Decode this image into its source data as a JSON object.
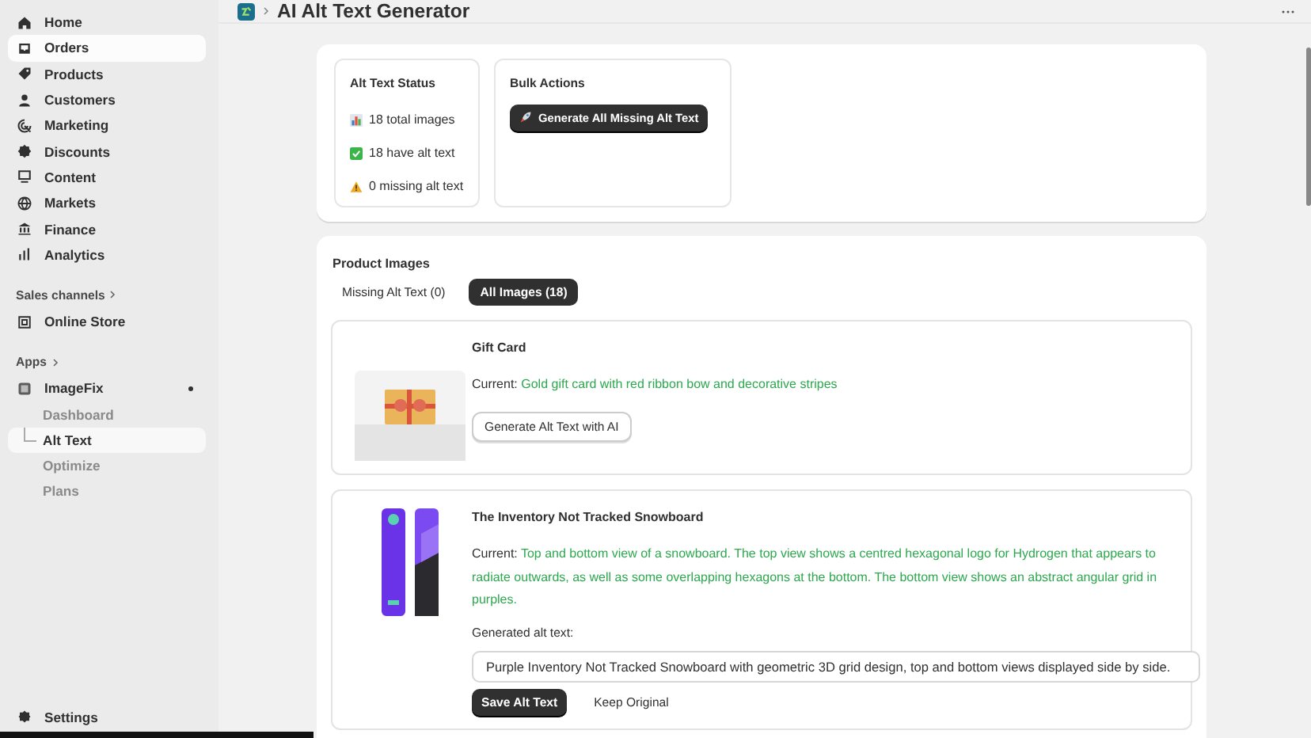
{
  "sidebar": {
    "nav": [
      {
        "label": "Home",
        "selected": false
      },
      {
        "label": "Orders",
        "selected": true
      },
      {
        "label": "Products",
        "selected": false
      },
      {
        "label": "Customers",
        "selected": false
      },
      {
        "label": "Marketing",
        "selected": false
      },
      {
        "label": "Discounts",
        "selected": false
      },
      {
        "label": "Content",
        "selected": false
      },
      {
        "label": "Markets",
        "selected": false
      },
      {
        "label": "Finance",
        "selected": false
      },
      {
        "label": "Analytics",
        "selected": false
      }
    ],
    "sales_channels": {
      "label": "Sales channels",
      "items": [
        {
          "label": "Online Store"
        }
      ]
    },
    "apps": {
      "label": "Apps",
      "items": [
        {
          "label": "ImageFix",
          "children": [
            {
              "label": "Dashboard",
              "selected": false
            },
            {
              "label": "Alt Text",
              "selected": true
            },
            {
              "label": "Optimize",
              "selected": false
            },
            {
              "label": "Plans",
              "selected": false
            }
          ]
        }
      ]
    },
    "settings": "Settings"
  },
  "header": {
    "title": "AI Alt Text Generator"
  },
  "status": {
    "title": "Alt Text Status",
    "stats": [
      {
        "kind": "chart",
        "text": "18 total images"
      },
      {
        "kind": "check",
        "text": "18 have alt text"
      },
      {
        "kind": "warning",
        "text": "0 missing alt text"
      }
    ]
  },
  "bulk": {
    "title": "Bulk Actions",
    "button": "Generate All Missing Alt Text"
  },
  "product_images": {
    "title": "Product Images",
    "tabs": [
      {
        "label": "Missing Alt Text (0)",
        "selected": false
      },
      {
        "label": "All Images (18)",
        "selected": true
      }
    ],
    "products": [
      {
        "name": "Gift Card",
        "current_label": "Current:",
        "current": "Gold gift card with red ribbon bow and decorative stripes",
        "generate_button": "Generate Alt Text with AI"
      },
      {
        "name": "The Inventory Not Tracked Snowboard",
        "current_label": "Current:",
        "current": "Top and bottom view of a snowboard. The top view shows a centred hexagonal logo for Hydrogen that appears to radiate outwards, as well as some overlapping hexagons at the bottom. The bottom view shows an abstract angular grid in purples.",
        "generated_label": "Generated alt text:",
        "generated_value": "Purple Inventory Not Tracked Snowboard with geometric 3D grid design, top and bottom views displayed side by side.",
        "save_button": "Save Alt Text",
        "keep_button": "Keep Original"
      }
    ]
  }
}
